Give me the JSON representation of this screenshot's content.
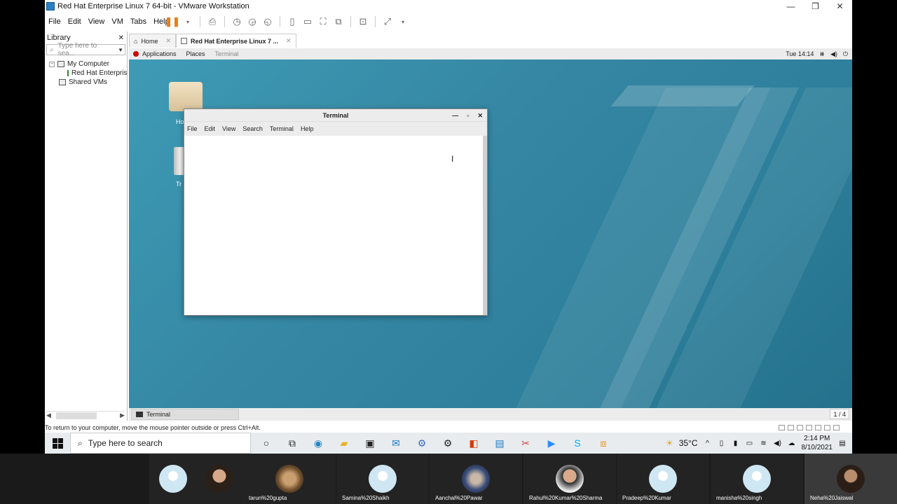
{
  "window": {
    "title": "Red Hat Enterprise Linux 7 64-bit - VMware Workstation",
    "min": "—",
    "max": "❐",
    "close": "✕"
  },
  "menu": [
    "File",
    "Edit",
    "View",
    "VM",
    "Tabs",
    "Help"
  ],
  "library": {
    "title": "Library",
    "close": "✕",
    "search_placeholder": "Type here to sea...",
    "tree": [
      {
        "label": "My Computer"
      },
      {
        "label": "Red Hat Enterprise"
      },
      {
        "label": "Shared VMs"
      }
    ]
  },
  "tabs": [
    {
      "label": "Home",
      "close": "✕"
    },
    {
      "label": "Red Hat Enterprise Linux 7 ...",
      "close": "✕"
    }
  ],
  "gnome": {
    "apps": "Applications",
    "places": "Places",
    "active": "Terminal",
    "clock": "Tue 14:14",
    "taskbar_item": "Terminal",
    "workspace": "1 / 4"
  },
  "desktop": {
    "folder_label": "Ho",
    "trash_label": "Tr"
  },
  "terminal": {
    "title": "Terminal",
    "menu": [
      "File",
      "Edit",
      "View",
      "Search",
      "Terminal",
      "Help"
    ]
  },
  "status": "To return to your computer, move the mouse pointer outside or press Ctrl+Alt.",
  "taskbar": {
    "search": "Type here to search",
    "weather": "35°C",
    "time": "2:14 PM",
    "date": "8/10/2021"
  },
  "meeting": [
    {
      "name": ""
    },
    {
      "name": ""
    },
    {
      "name": "tarun%20gupta"
    },
    {
      "name": "Samina%20Shaikh"
    },
    {
      "name": "Aanchal%20Pawar"
    },
    {
      "name": "Rahul%20Kumar%20Sharma"
    },
    {
      "name": "Pradeep%20Kumar"
    },
    {
      "name": "manisha%20singh"
    },
    {
      "name": "Neha%20Jaiswal"
    }
  ],
  "colors": {
    "desktop": "#3587a3",
    "pause": "#e57f1b",
    "meeting_bg": "#1a1a1a"
  }
}
